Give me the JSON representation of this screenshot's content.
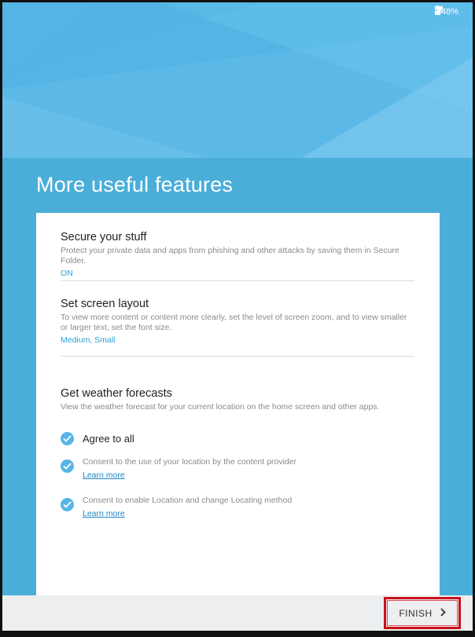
{
  "status_bar": {
    "battery": "48%",
    "icons": [
      "wifi-icon",
      "signal-icon",
      "battery-icon"
    ]
  },
  "page": {
    "title": "More useful features"
  },
  "sections": [
    {
      "title": "Secure your stuff",
      "description": "Protect your private data and apps from phishing and other attacks by saving them in Secure Folder.",
      "value": "ON"
    },
    {
      "title": "Set screen layout",
      "description": "To view more content or content more clearly, set the level of screen zoom, and to view smaller or larger text, set the font size.",
      "value": "Medium, Small"
    },
    {
      "title": "Get weather forecasts",
      "description": "View the weather forecast for your current location on the home screen and other apps."
    }
  ],
  "weather_options": {
    "agree_all": "Agree to all",
    "consents": [
      {
        "text": "Consent to the use of your location by the content provider",
        "link": "Learn more"
      },
      {
        "text": "Consent to enable Location and change Locating method",
        "link": "Learn more"
      }
    ]
  },
  "bottom_bar": {
    "finish_label": "FINISH"
  },
  "colors": {
    "accent": "#2a9fd6",
    "header_blue": "#4aaed9",
    "check_blue": "#55b6e6",
    "highlight_red": "#c8101a"
  }
}
